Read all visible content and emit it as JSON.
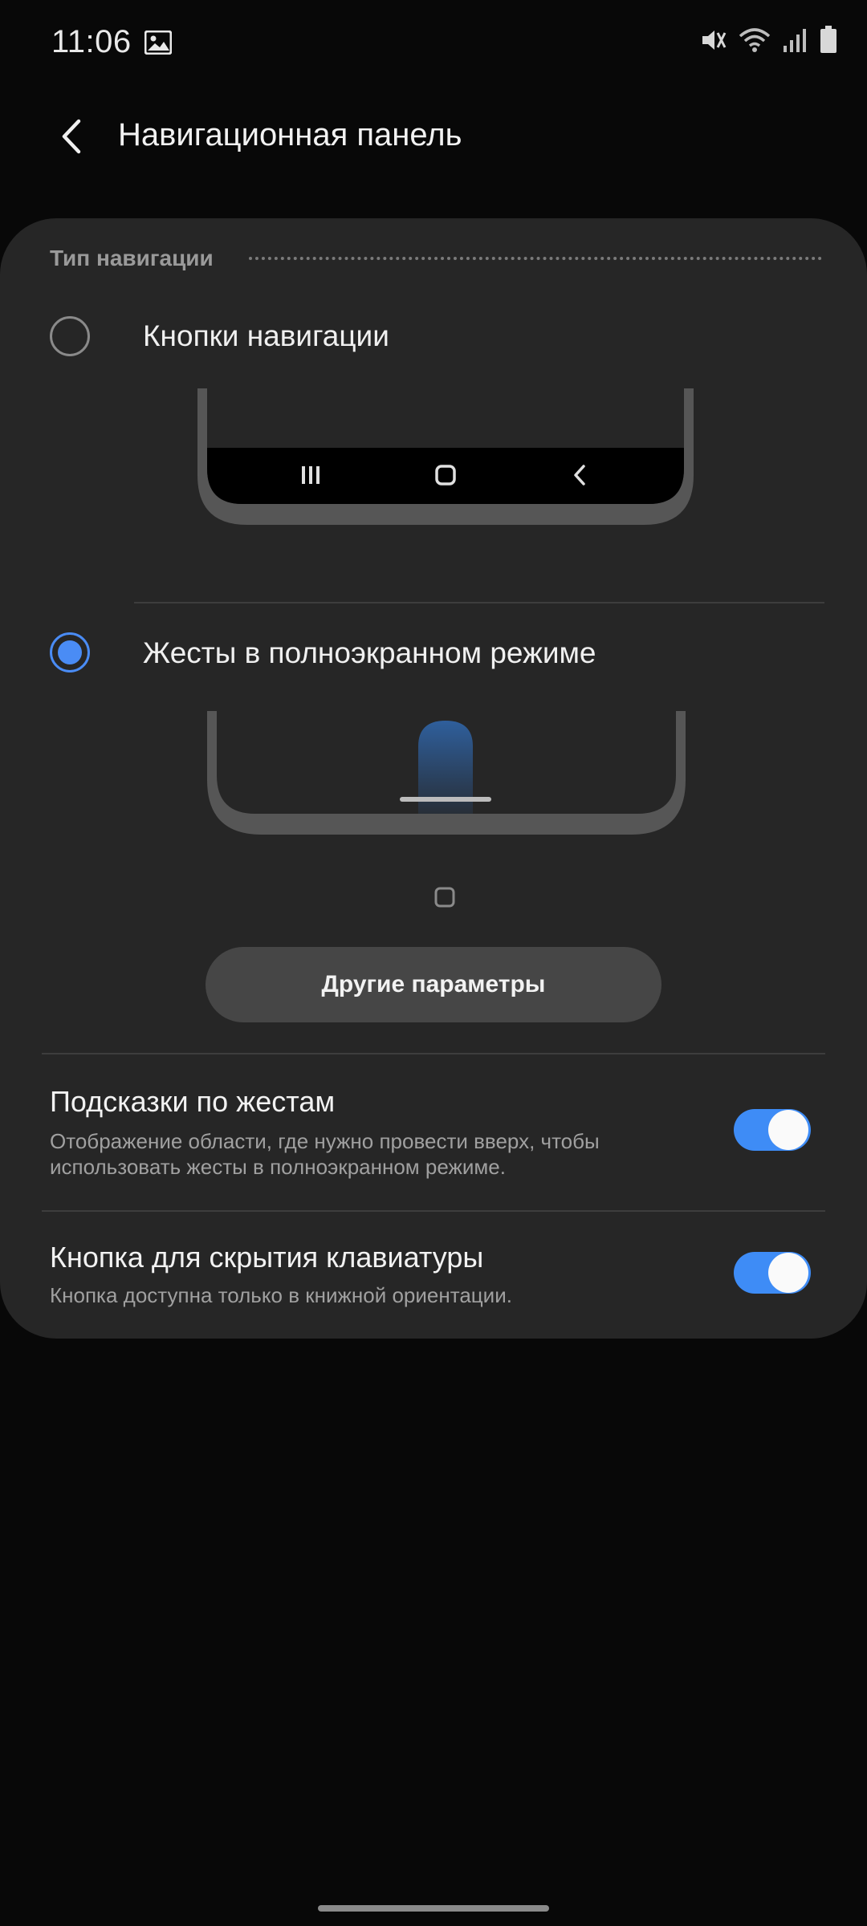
{
  "status_bar": {
    "time": "11:06",
    "icons": [
      "image-icon",
      "mute-icon",
      "wifi-icon",
      "signal-icon",
      "battery-icon"
    ]
  },
  "app_bar": {
    "title": "Навигационная панель",
    "back_icon": "back-arrow-icon"
  },
  "navigation_type": {
    "header": "Тип навигации",
    "options": [
      {
        "label": "Кнопки навигации",
        "selected": false,
        "preview_icons": [
          "recent-apps-icon",
          "home-icon",
          "back-icon"
        ]
      },
      {
        "label": "Жесты в полноэкранном режиме",
        "selected": true
      }
    ],
    "more_button": "Другие параметры"
  },
  "settings": [
    {
      "title": "Подсказки по жестам",
      "description": "Отображение области, где нужно провести вверх, чтобы использовать жесты в полноэкранном режиме.",
      "enabled": true
    },
    {
      "title": "Кнопка для скрытия клавиатуры",
      "description": "Кнопка доступна только в книжной ориентации.",
      "enabled": true
    }
  ],
  "colors": {
    "background": "#080808",
    "card": "#262626",
    "accent": "#3e8cf6",
    "radio_selected": "#4a8cf5"
  }
}
